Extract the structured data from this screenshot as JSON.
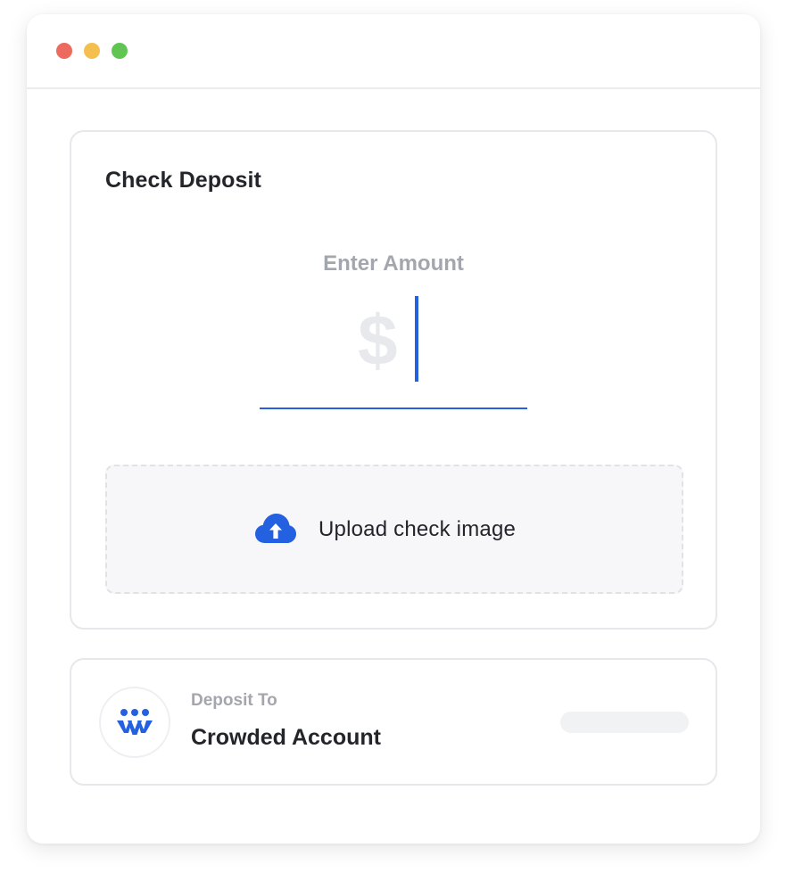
{
  "window": {
    "controls": [
      "close",
      "minimize",
      "maximize"
    ]
  },
  "check_deposit": {
    "title": "Check Deposit",
    "amount": {
      "label": "Enter Amount",
      "currency_symbol": "$",
      "value": ""
    },
    "upload": {
      "label": "Upload check image",
      "icon": "cloud-upload-icon"
    }
  },
  "deposit_to": {
    "label": "Deposit To",
    "account_name": "Crowded Account",
    "logo_icon": "crowded-logo-icon"
  },
  "colors": {
    "accent": "#2461e0",
    "muted_text": "#a4a6ad",
    "primary_text": "#24252b"
  }
}
